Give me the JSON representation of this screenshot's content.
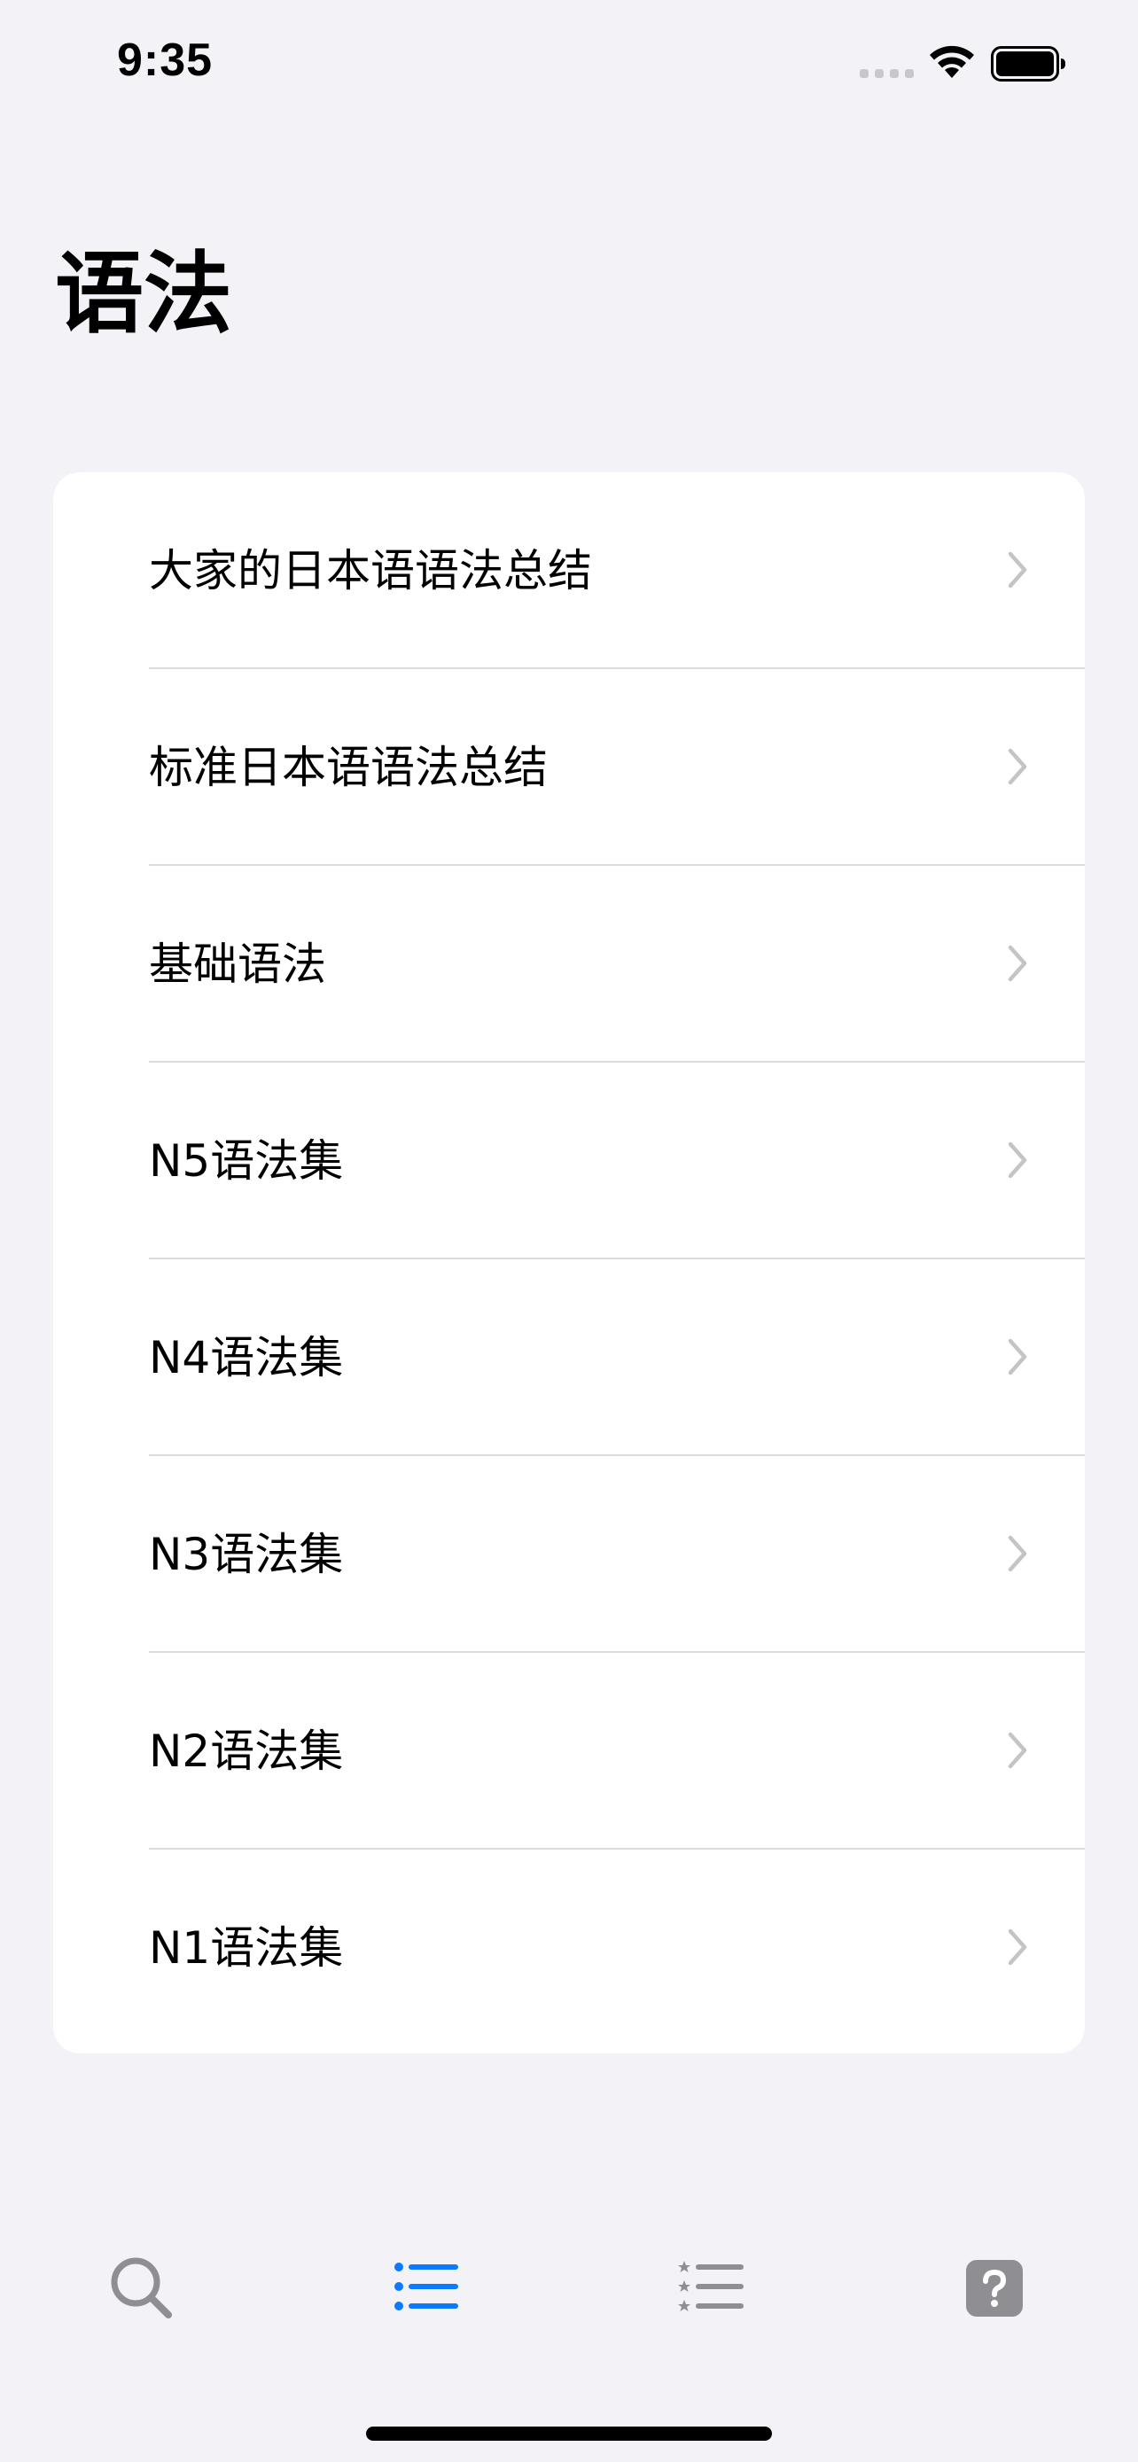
{
  "status_bar": {
    "time": "9:35"
  },
  "page": {
    "title": "语法"
  },
  "list": {
    "items": [
      {
        "label": "大家的日本语语法总结"
      },
      {
        "label": "标准日本语语法总结"
      },
      {
        "label": "基础语法"
      },
      {
        "label": "N5语法集"
      },
      {
        "label": "N4语法集"
      },
      {
        "label": "N3语法集"
      },
      {
        "label": "N2语法集"
      },
      {
        "label": "N1语法集"
      }
    ]
  },
  "tab_bar": {
    "active_index": 1,
    "tabs": [
      {
        "icon": "search-icon"
      },
      {
        "icon": "list-bullet-icon"
      },
      {
        "icon": "list-star-icon"
      },
      {
        "icon": "question-mark-icon"
      }
    ]
  },
  "colors": {
    "background": "#f2f2f7",
    "card": "#ffffff",
    "accent": "#0a7aff",
    "inactive_icon": "#8e8e93",
    "chevron": "#c4c4c7",
    "separator": "#dcdce0"
  }
}
